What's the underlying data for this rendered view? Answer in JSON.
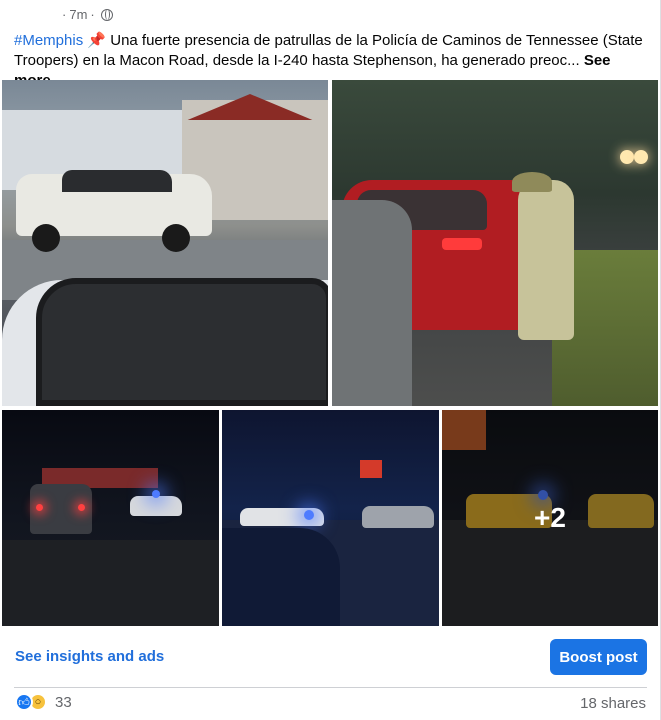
{
  "post": {
    "time": "7m",
    "separator": "·",
    "hashtag": "#Memphis",
    "pin_emoji": "📌",
    "body": " Una fuerte presencia de patrullas de la Policía de Caminos de Tennessee (State Troopers) en la Macon Road, desde la I-240 hasta Stephenson, ha generado preoc...",
    "see_more": "See more"
  },
  "gallery": {
    "extra_count_label": "+2"
  },
  "actions": {
    "insights_label": "See insights and ads",
    "boost_label": "Boost post"
  },
  "footer": {
    "reaction_count": "33",
    "shares_label": "18 shares"
  },
  "icons": {
    "like": "like-reaction-icon",
    "wow": "wow-reaction-icon",
    "audience": "globe-icon"
  },
  "colors": {
    "link_blue": "#216fdb",
    "boost_blue": "#1b74e4"
  }
}
